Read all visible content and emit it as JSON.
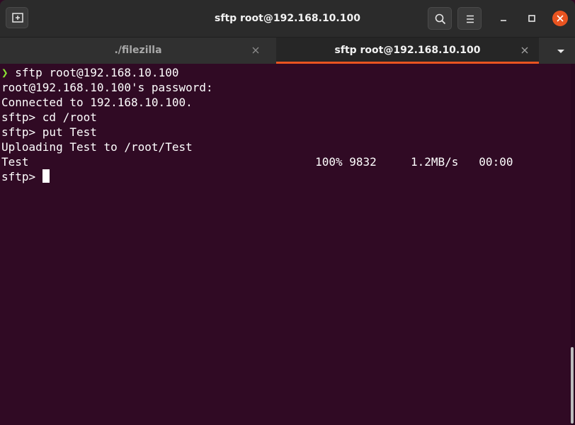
{
  "window": {
    "title": "sftp root@192.168.10.100"
  },
  "tabs": [
    {
      "label": "./filezilla",
      "active": false
    },
    {
      "label": "sftp root@192.168.10.100",
      "active": true
    }
  ],
  "icons": {
    "new_tab": "new-tab-icon",
    "search": "search-icon",
    "menu": "hamburger-menu-icon",
    "minimize": "minimize-icon",
    "maximize": "maximize-icon",
    "close": "close-icon",
    "tab_close": "close-icon",
    "tab_dropdown": "chevron-down-icon"
  },
  "colors": {
    "terminal_bg": "#300a24",
    "accent": "#e95420",
    "prompt_arrow": "#8ae234"
  },
  "terminal": {
    "lines": [
      {
        "glyph": "❯",
        "text": " sftp root@192.168.10.100"
      },
      {
        "text": "root@192.168.10.100's password:"
      },
      {
        "text": "Connected to 192.168.10.100."
      },
      {
        "text": "sftp> cd /root"
      },
      {
        "text": "sftp> put Test"
      },
      {
        "text": "Uploading Test to /root/Test"
      },
      {
        "text": "Test                                          100% 9832     1.2MB/s   00:00"
      },
      {
        "text": "sftp> "
      }
    ]
  }
}
